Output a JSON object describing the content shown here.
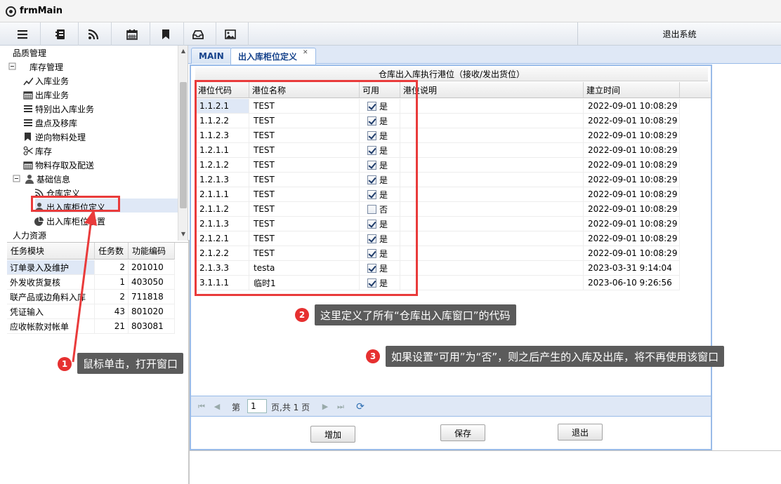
{
  "window": {
    "title": "frmMain"
  },
  "toolbar": {
    "exit_label": "退出系统"
  },
  "tree": {
    "items": [
      {
        "label": "品质管理",
        "level": 0,
        "icon": "none"
      },
      {
        "label": "库存管理",
        "level": 0,
        "icon": "collapse"
      },
      {
        "label": "入库业务",
        "level": 2,
        "icon": "line-chart-icon"
      },
      {
        "label": "出库业务",
        "level": 2,
        "icon": "calendar-icon"
      },
      {
        "label": "特别出入库业务",
        "level": 2,
        "icon": "list-icon"
      },
      {
        "label": "盘点及移库",
        "level": 2,
        "icon": "list-icon"
      },
      {
        "label": "逆向物料处理",
        "level": 2,
        "icon": "bookmark-icon"
      },
      {
        "label": "库存",
        "level": 2,
        "icon": "scissors-icon"
      },
      {
        "label": "物料存取及配送",
        "level": 2,
        "icon": "calendar-icon"
      },
      {
        "label": "基础信息",
        "level": 1,
        "icon": "user-icon"
      },
      {
        "label": "仓库定义",
        "level": 3,
        "icon": "rss-icon"
      },
      {
        "label": "出入库柜位定义",
        "level": 3,
        "icon": "user-icon"
      },
      {
        "label": "出入库柜位设置",
        "level": 3,
        "icon": "pie-chart-icon"
      },
      {
        "label": "人力资源",
        "level": 0,
        "icon": "none"
      }
    ]
  },
  "task_grid": {
    "headers": [
      "任务模块",
      "任务数",
      "功能编码"
    ],
    "rows": [
      [
        "订单录入及维护",
        "2",
        "201010"
      ],
      [
        "外发收货复核",
        "1",
        "403050"
      ],
      [
        "联产品或边角料入库",
        "2",
        "711818"
      ],
      [
        "凭证输入",
        "43",
        "801020"
      ],
      [
        "应收帐款对帐单",
        "21",
        "803081"
      ]
    ]
  },
  "tabs": [
    {
      "label": "MAIN"
    },
    {
      "label": "出入库柜位定义"
    }
  ],
  "grid": {
    "caption": "仓库出入库执行港位（接收/发出货位）",
    "headers": [
      "港位代码",
      "港位名称",
      "可用",
      "港位说明",
      "建立时间"
    ],
    "rows": [
      {
        "code": "1.1.2.1",
        "name": "TEST",
        "enabled": "是",
        "note": "",
        "created": "2022-09-01 10:08:29"
      },
      {
        "code": "1.1.2.2",
        "name": "TEST",
        "enabled": "是",
        "note": "",
        "created": "2022-09-01 10:08:29"
      },
      {
        "code": "1.1.2.3",
        "name": "TEST",
        "enabled": "是",
        "note": "",
        "created": "2022-09-01 10:08:29"
      },
      {
        "code": "1.2.1.1",
        "name": "TEST",
        "enabled": "是",
        "note": "",
        "created": "2022-09-01 10:08:29"
      },
      {
        "code": "1.2.1.2",
        "name": "TEST",
        "enabled": "是",
        "note": "",
        "created": "2022-09-01 10:08:29"
      },
      {
        "code": "1.2.1.3",
        "name": "TEST",
        "enabled": "是",
        "note": "",
        "created": "2022-09-01 10:08:29"
      },
      {
        "code": "2.1.1.1",
        "name": "TEST",
        "enabled": "是",
        "note": "",
        "created": "2022-09-01 10:08:29"
      },
      {
        "code": "2.1.1.2",
        "name": "TEST",
        "enabled": "否",
        "note": "",
        "created": "2022-09-01 10:08:29"
      },
      {
        "code": "2.1.1.3",
        "name": "TEST",
        "enabled": "是",
        "note": "",
        "created": "2022-09-01 10:08:29"
      },
      {
        "code": "2.1.2.1",
        "name": "TEST",
        "enabled": "是",
        "note": "",
        "created": "2022-09-01 10:08:29"
      },
      {
        "code": "2.1.2.2",
        "name": "TEST",
        "enabled": "是",
        "note": "",
        "created": "2022-09-01 10:08:29"
      },
      {
        "code": "2.1.3.3",
        "name": "testa",
        "enabled": "是",
        "note": "",
        "created": "2023-03-31 9:14:04"
      },
      {
        "code": "3.1.1.1",
        "name": "临时1",
        "enabled": "是",
        "note": "",
        "created": "2023-06-10 9:26:56"
      }
    ]
  },
  "pager": {
    "page_prefix": "第",
    "page_value": "1",
    "page_suffix": "页,共 1 页"
  },
  "buttons": {
    "add": "增加",
    "save": "保存",
    "exit": "退出"
  },
  "annotations": [
    {
      "number": "1",
      "text": "鼠标单击，打开窗口"
    },
    {
      "number": "2",
      "text": "这里定义了所有“仓库出入库窗口”的代码"
    },
    {
      "number": "3",
      "text": "如果设置“可用”为“否”，则之后产生的入库及出库，将不再使用该窗口"
    }
  ],
  "colors": {
    "annotation_red": "#e93b3b",
    "tab_border": "#99bbe8",
    "selection": "#dfe8f6"
  }
}
